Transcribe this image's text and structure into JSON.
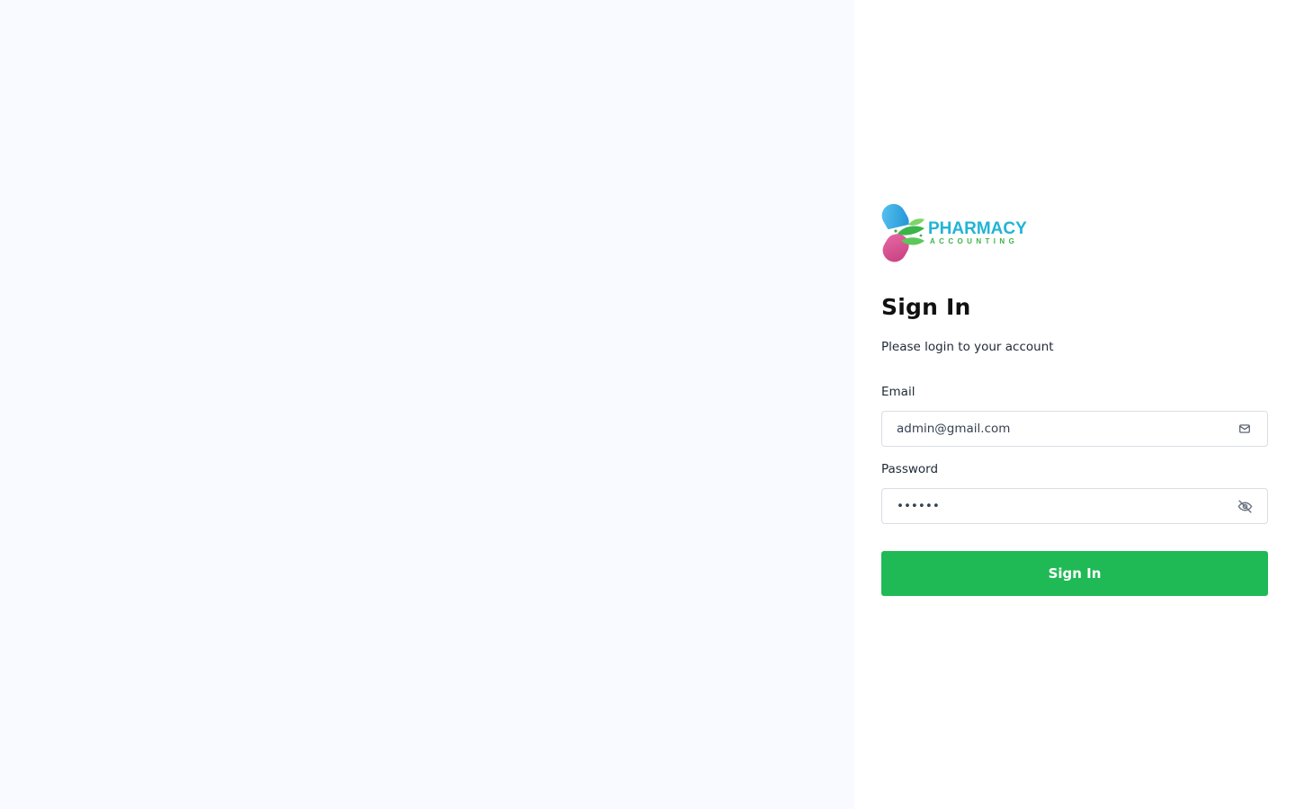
{
  "brand": {
    "name": "PHARMACY",
    "tagline": "ACCOUNTING",
    "primary_color": "#21b4d6",
    "secondary_color": "#3ab54a",
    "pill_top_color": "#2fa9e0",
    "pill_bottom_color": "#d94f8f"
  },
  "login": {
    "title": "Sign In",
    "subtitle": "Please login to your account",
    "email_label": "Email",
    "email_value": "admin@gmail.com",
    "email_icon": "mail-icon",
    "password_label": "Password",
    "password_value": "123456",
    "password_icon": "eye-off-icon",
    "submit_label": "Sign In",
    "submit_color": "#1fba55"
  },
  "layout_colors": {
    "left_panel_bg": "#f8faff",
    "right_panel_bg": "#ffffff"
  }
}
